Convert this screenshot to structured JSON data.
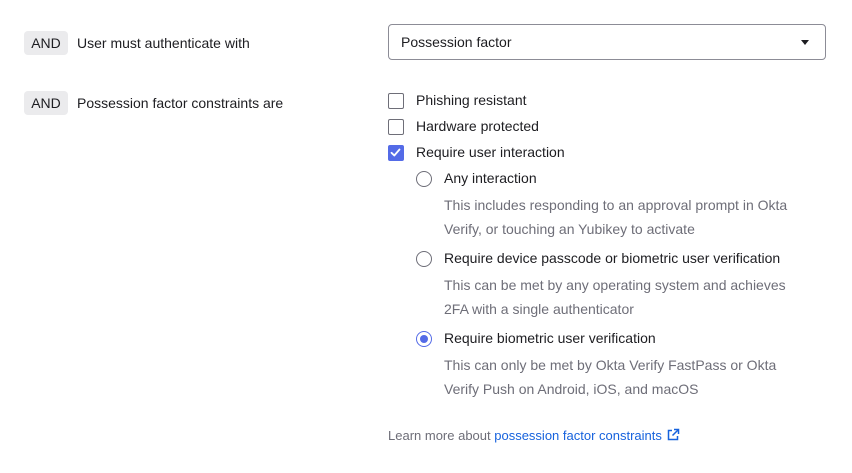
{
  "rows": [
    {
      "operator": "AND",
      "label": "User must authenticate with"
    },
    {
      "operator": "AND",
      "label": "Possession factor constraints are"
    }
  ],
  "authenticator_select": {
    "value": "Possession factor"
  },
  "constraints": [
    {
      "label": "Phishing resistant",
      "checked": false
    },
    {
      "label": "Hardware protected",
      "checked": false
    },
    {
      "label": "Require user interaction",
      "checked": true
    }
  ],
  "interaction_options": [
    {
      "label": "Any interaction",
      "help_line1": "This includes responding to an approval prompt in Okta",
      "help_line2": "Verify, or touching an Yubikey to activate",
      "selected": false
    },
    {
      "label": "Require device passcode or biometric user verification",
      "help_line1": "This can be met by any operating system and achieves",
      "help_line2": "2FA with a single authenticator",
      "selected": false
    },
    {
      "label": "Require biometric user verification",
      "help_line1": "This can only be met by Okta Verify FastPass or Okta",
      "help_line2": "Verify Push on Android, iOS, and macOS",
      "selected": true
    }
  ],
  "footer": {
    "prefix": "Learn more about ",
    "link_text": "possession factor constraints",
    "link_icon": "external-link-icon"
  },
  "colors": {
    "accent": "#546be7",
    "link": "#1662dd",
    "muted_text": "#6e6e78",
    "badge_bg": "#ebebed"
  }
}
